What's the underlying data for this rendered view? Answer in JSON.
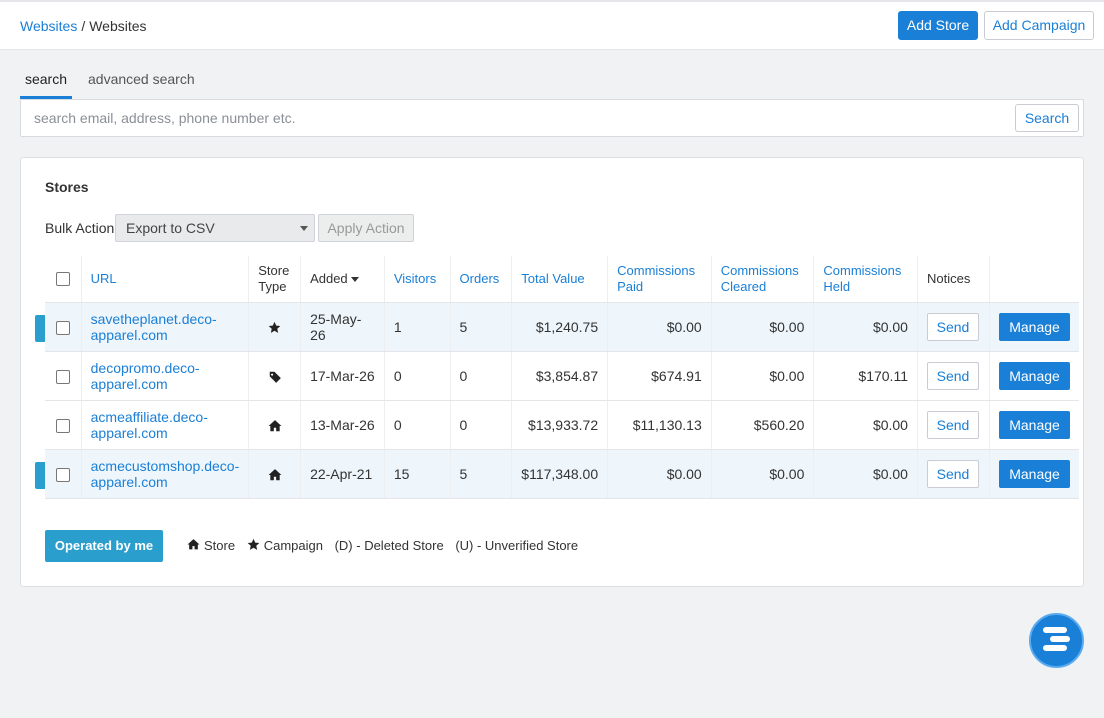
{
  "breadcrumb": {
    "root": "Websites",
    "separator": "/",
    "current": "Websites"
  },
  "header": {
    "add_store": "Add Store",
    "add_campaign": "Add Campaign"
  },
  "tabs": [
    {
      "label": "search",
      "active": true
    },
    {
      "label": "advanced search",
      "active": false
    }
  ],
  "search": {
    "placeholder": "search email, address, phone number etc.",
    "value": "",
    "button": "Search"
  },
  "stores": {
    "title": "Stores",
    "bulk_label": "Bulk Action",
    "bulk_selected": "Export to CSV",
    "apply_label": "Apply Action",
    "columns": {
      "url": "URL",
      "store_type": "Store Type",
      "added": "Added",
      "visitors": "Visitors",
      "orders": "Orders",
      "total_value": "Total Value",
      "commissions_paid": "Commissions Paid",
      "commissions_cleared": "Commissions Cleared",
      "commissions_held": "Commissions Held",
      "notices": "Notices"
    },
    "rows": [
      {
        "url": "savetheplanet.deco-apparel.com",
        "type_icon": "star-icon",
        "added": "25-May-26",
        "visitors": "1",
        "orders": "5",
        "total_value": "$1,240.75",
        "paid": "$0.00",
        "cleared": "$0.00",
        "held": "$0.00",
        "send": "Send",
        "manage": "Manage",
        "highlighted": true
      },
      {
        "url": "decopromo.deco-apparel.com",
        "type_icon": "tag-icon",
        "added": "17-Mar-26",
        "visitors": "0",
        "orders": "0",
        "total_value": "$3,854.87",
        "paid": "$674.91",
        "cleared": "$0.00",
        "held": "$170.11",
        "send": "Send",
        "manage": "Manage",
        "highlighted": false
      },
      {
        "url": "acmeaffiliate.deco-apparel.com",
        "type_icon": "home-icon",
        "added": "13-Mar-26",
        "visitors": "0",
        "orders": "0",
        "total_value": "$13,933.72",
        "paid": "$11,130.13",
        "cleared": "$560.20",
        "held": "$0.00",
        "send": "Send",
        "manage": "Manage",
        "highlighted": false
      },
      {
        "url": "acmecustomshop.deco-apparel.com",
        "type_icon": "home-icon",
        "added": "22-Apr-21",
        "visitors": "15",
        "orders": "5",
        "total_value": "$117,348.00",
        "paid": "$0.00",
        "cleared": "$0.00",
        "held": "$0.00",
        "send": "Send",
        "manage": "Manage",
        "highlighted": true
      }
    ],
    "operated_by_me": "Operated by me",
    "legend": {
      "store": "Store",
      "campaign": "Campaign",
      "deleted": "(D) - Deleted Store",
      "unverified": "(U) - Unverified Store"
    }
  },
  "colors": {
    "primary": "#1a7fd6",
    "accent_teal": "#2a9fce",
    "row_highlight": "#eef6fc",
    "background": "#f1f2f4"
  }
}
